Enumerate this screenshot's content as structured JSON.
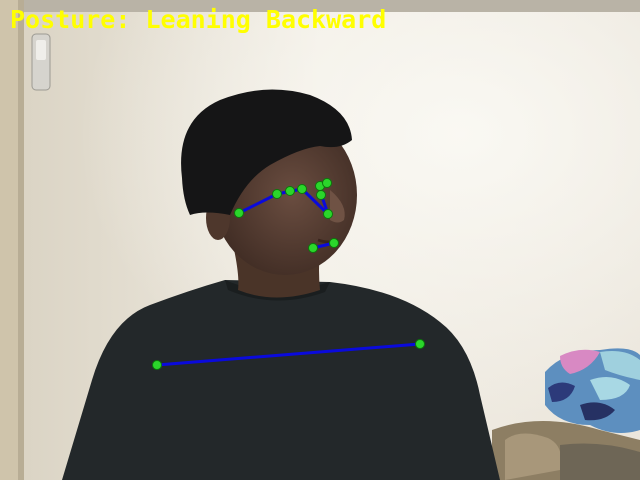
{
  "overlay": {
    "posture_prefix": "Posture:",
    "posture_value": "Leaning Backward",
    "text_color": "#ffff00"
  },
  "pose": {
    "keypoint_color": "#2bd62b",
    "connection_color": "#0a0adc"
  }
}
